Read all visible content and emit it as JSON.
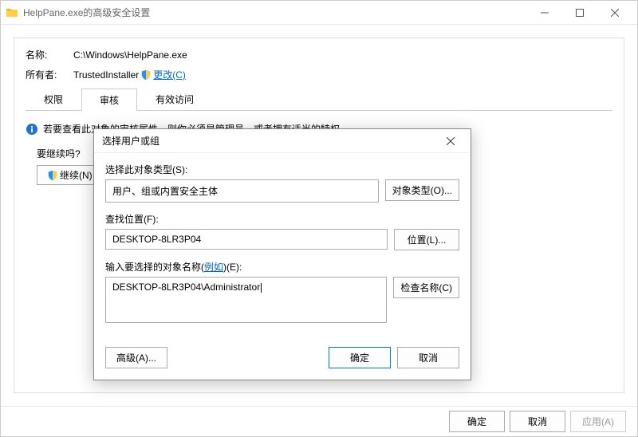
{
  "window": {
    "title": "HelpPane.exe的高级安全设置"
  },
  "fields": {
    "name_label": "名称:",
    "name_value": "C:\\Windows\\HelpPane.exe",
    "owner_label": "所有者:",
    "owner_value": "TrustedInstaller",
    "change_link": "更改(C)"
  },
  "tabs": {
    "perm": "权限",
    "audit": "审核",
    "effective": "有效访问"
  },
  "info_text": "若要查看此对象的审核属性，则你必须是管理员，或者拥有适当的特权。",
  "continue": {
    "label": "要继续吗?",
    "btn": "继续(N)"
  },
  "bottom": {
    "ok": "确定",
    "cancel": "取消",
    "apply": "应用(A)"
  },
  "modal": {
    "title": "选择用户或组",
    "type_label": "选择此对象类型(S):",
    "type_value": "用户、组或内置安全主体",
    "type_btn": "对象类型(O)...",
    "loc_label": "查找位置(F):",
    "loc_value": "DESKTOP-8LR3P04",
    "loc_btn": "位置(L)...",
    "names_label_prefix": "输入要选择的对象名称(",
    "names_label_link": "例如",
    "names_label_suffix": ")(E):",
    "names_value": "DESKTOP-8LR3P04\\Administrator",
    "check_btn": "检查名称(C)",
    "advanced_btn": "高级(A)...",
    "ok": "确定",
    "cancel": "取消"
  }
}
